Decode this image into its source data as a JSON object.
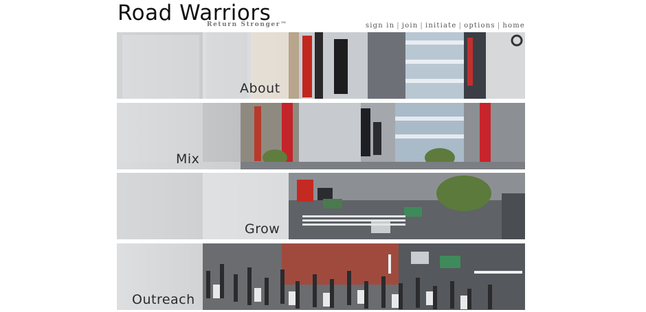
{
  "site": {
    "title": "Road Warriors",
    "tagline": "Return Stronger™"
  },
  "topnav": {
    "items": [
      {
        "label": "sign in"
      },
      {
        "label": "join"
      },
      {
        "label": "initiate"
      },
      {
        "label": "options"
      },
      {
        "label": "home"
      }
    ],
    "separator": "|"
  },
  "bands": [
    {
      "label": "About"
    },
    {
      "label": "Mix"
    },
    {
      "label": "Grow"
    },
    {
      "label": "Outreach"
    }
  ],
  "colors": {
    "background": "#ffffff",
    "text": "#111111",
    "nav": "#555555",
    "tagline": "#777777"
  }
}
